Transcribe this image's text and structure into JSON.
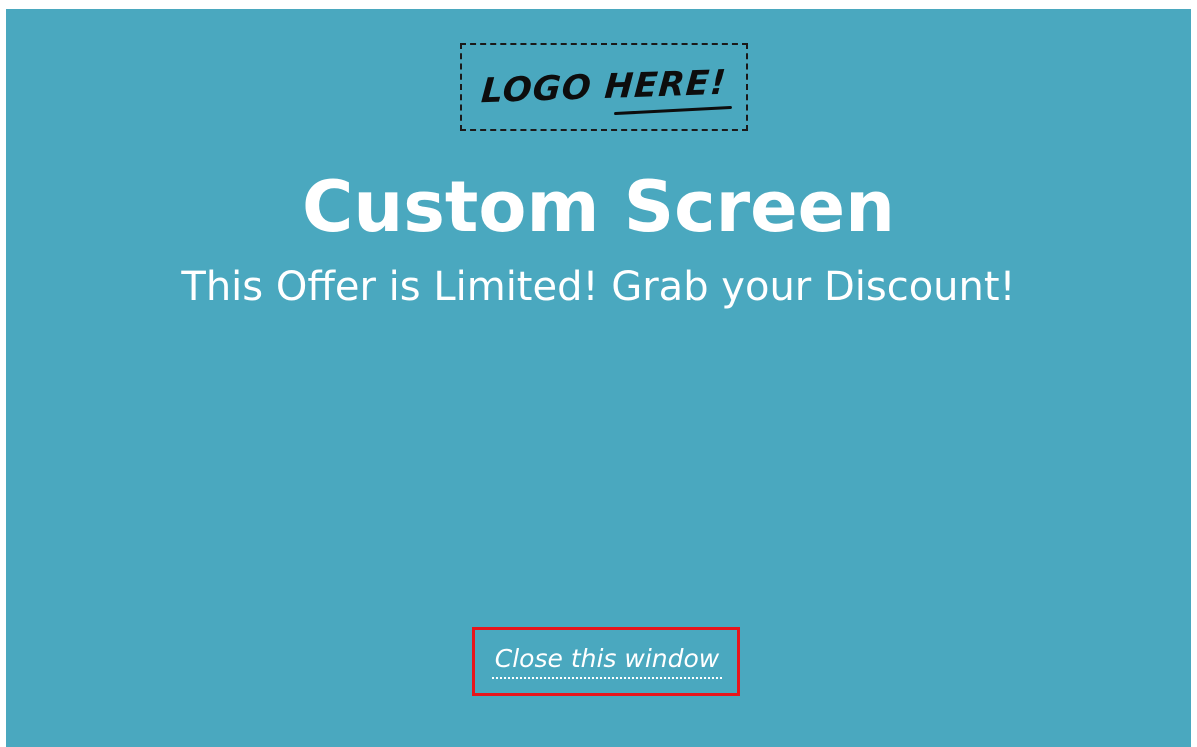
{
  "screen": {
    "background_color": "#4aa8bf",
    "logo": {
      "text": "LOGO HERE!"
    },
    "title": "Custom Screen",
    "subtitle": "This Offer is Limited! Grab your Discount!",
    "close_link": "Close this window",
    "highlight_color": "#e8151b"
  }
}
